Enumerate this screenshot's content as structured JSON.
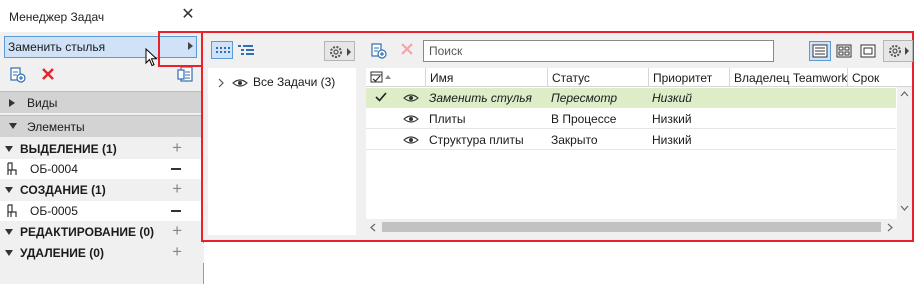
{
  "window": {
    "title": "Менеджер Задач",
    "close_icon": "close-icon"
  },
  "task_selector": {
    "current_value": "Заменить стылья"
  },
  "left_toolbar": {
    "add_icon": "add-task-icon",
    "delete_icon": "delete-icon",
    "settings_icon": "task-settings-icon"
  },
  "sections": {
    "views": "Виды",
    "elements": "Элементы"
  },
  "element_groups": [
    {
      "label": "ВЫДЕЛЕНИЕ (1)",
      "items": [
        "ОБ-0004"
      ]
    },
    {
      "label": "СОЗДАНИЕ (1)",
      "items": [
        "ОБ-0005"
      ]
    },
    {
      "label": "РЕДАКТИРОВАНИЕ (0)",
      "items": []
    },
    {
      "label": "УДАЛЕНИЕ (0)",
      "items": []
    }
  ],
  "tree": {
    "root_label": "Все Задачи (3)"
  },
  "search": {
    "placeholder": "Поиск"
  },
  "table": {
    "columns": [
      "Имя",
      "Статус",
      "Приоритет",
      "Владелец Teamwork",
      "Срок"
    ],
    "rows": [
      {
        "done": true,
        "visible": true,
        "name": "Заменить стулья",
        "status": "Пересмотр",
        "priority": "Низкий",
        "owner": "",
        "deadline": "",
        "selected": true
      },
      {
        "done": false,
        "visible": true,
        "name": "Плиты",
        "status": "В Процессе",
        "priority": "Низкий",
        "owner": "",
        "deadline": "",
        "selected": false
      },
      {
        "done": false,
        "visible": true,
        "name": "Структура плиты",
        "status": "Закрыто",
        "priority": "Низкий",
        "owner": "",
        "deadline": "",
        "selected": false
      }
    ]
  },
  "colors": {
    "highlight_border": "#e8212b",
    "selected_row": "#dcedc8",
    "selection_blue": "#cfe2f7",
    "delete_red": "#e8212b",
    "accent_blue": "#2f6fb5"
  }
}
